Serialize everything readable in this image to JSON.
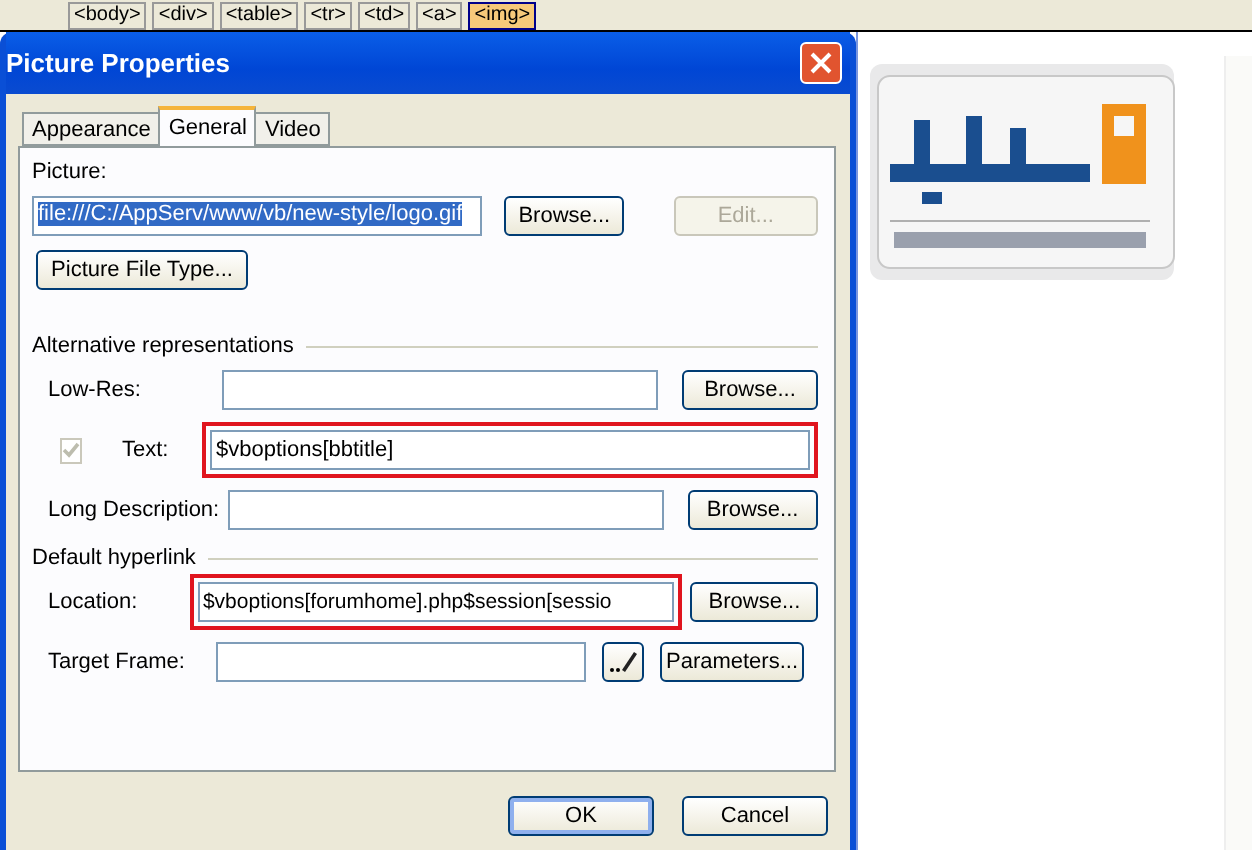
{
  "breadcrumb": [
    {
      "label": "<body>",
      "selected": false
    },
    {
      "label": "<div>",
      "selected": false
    },
    {
      "label": "<table>",
      "selected": false
    },
    {
      "label": "<tr>",
      "selected": false
    },
    {
      "label": "<td>",
      "selected": false
    },
    {
      "label": "<a>",
      "selected": false
    },
    {
      "label": "<img>",
      "selected": true
    }
  ],
  "dialog": {
    "title": "Picture Properties",
    "tabs": [
      {
        "label": "Appearance",
        "selected": false
      },
      {
        "label": "General",
        "selected": true
      },
      {
        "label": "Video",
        "selected": false
      }
    ],
    "picture": {
      "label": "Picture:",
      "value": "file:///C:/AppServ/www/vb/new-style/logo.gif",
      "browse": {
        "label": "Browse...",
        "disabled": false
      },
      "edit": {
        "label": "Edit...",
        "disabled": true
      },
      "file_type_button": "Picture File Type..."
    },
    "groups": [
      {
        "title": "Alternative representations",
        "rows": [
          {
            "kind": "field",
            "label": "Low-Res:",
            "value": "",
            "highlighted": false,
            "button": "Browse..."
          },
          {
            "kind": "check",
            "label": "Text:",
            "checked": true,
            "disabled": true,
            "value": "$vboptions[bbtitle]",
            "highlighted": true
          },
          {
            "kind": "field",
            "label": "Long Description:",
            "value": "",
            "highlighted": false,
            "button": "Browse..."
          }
        ]
      },
      {
        "title": "Default hyperlink",
        "rows": [
          {
            "kind": "field",
            "label": "Location:",
            "value": "$vboptions[forumhome].php$session[sessio",
            "highlighted": true,
            "button": "Browse..."
          },
          {
            "kind": "picker",
            "label": "Target Frame:",
            "value": "",
            "highlighted": false,
            "button": "Parameters..."
          }
        ]
      }
    ],
    "buttons": [
      {
        "label": "OK",
        "default": true
      },
      {
        "label": "Cancel",
        "default": false
      }
    ]
  }
}
